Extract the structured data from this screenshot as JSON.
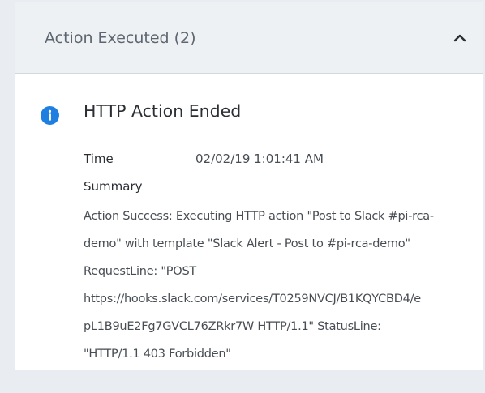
{
  "panel": {
    "title": "Action Executed (2)"
  },
  "event": {
    "title": "HTTP Action Ended",
    "icon": "info-icon",
    "icon_color": "#1f7fe1",
    "time_label": "Time",
    "time_value": "02/02/19 1:01:41 AM",
    "summary_label": "Summary",
    "summary_lines": [
      "Action Success: Executing HTTP action \"Post to Slack #pi-rca-",
      "demo\" with template \"Slack Alert - Post to #pi-rca-demo\"",
      "RequestLine: \"POST",
      "https://hooks.slack.com/services/T0259NVCJ/B1KQYCBD4/e",
      "pL1B9uE2Fg7GVCL76ZRkr7W HTTP/1.1\" StatusLine:",
      "\"HTTP/1.1 403 Forbidden\""
    ]
  },
  "colors": {
    "header_bg": "#eef1f4",
    "page_bg": "#e9edf2",
    "border": "#8e959c"
  }
}
